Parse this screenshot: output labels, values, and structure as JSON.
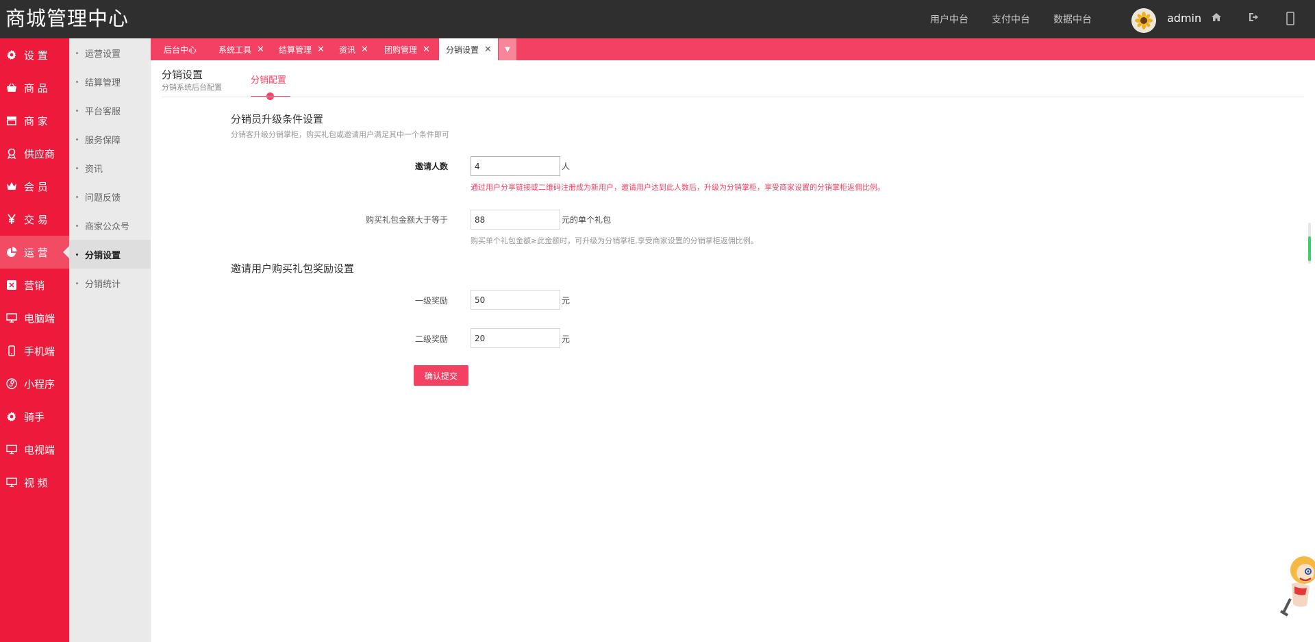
{
  "header": {
    "brand": "商城管理中心",
    "nav": [
      "用户中台",
      "支付中台",
      "数据中台"
    ],
    "username": "admin"
  },
  "sidebar": {
    "items": [
      {
        "label": "设 置",
        "icon": "gear-icon"
      },
      {
        "label": "商 品",
        "icon": "basket-icon"
      },
      {
        "label": "商 家",
        "icon": "store-icon"
      },
      {
        "label": "供应商",
        "icon": "badge-icon"
      },
      {
        "label": "会 员",
        "icon": "crown-icon"
      },
      {
        "label": "交 易",
        "icon": "yen-icon"
      },
      {
        "label": "运 营",
        "icon": "pie-chart-icon",
        "active": true
      },
      {
        "label": "营销",
        "icon": "coupon-icon"
      },
      {
        "label": "电脑端",
        "icon": "monitor-icon"
      },
      {
        "label": "手机端",
        "icon": "phone-icon"
      },
      {
        "label": "小程序",
        "icon": "mini-program-icon"
      },
      {
        "label": "骑手",
        "icon": "gear-icon"
      },
      {
        "label": "电视端",
        "icon": "monitor-icon"
      },
      {
        "label": "视 频",
        "icon": "monitor-icon"
      }
    ]
  },
  "subnav": {
    "items": [
      {
        "label": "运营设置"
      },
      {
        "label": "结算管理"
      },
      {
        "label": "平台客服"
      },
      {
        "label": "服务保障"
      },
      {
        "label": "资讯"
      },
      {
        "label": "问题反馈"
      },
      {
        "label": "商家公众号"
      },
      {
        "label": "分销设置",
        "active": true
      },
      {
        "label": "分销统计"
      }
    ]
  },
  "tabs": [
    {
      "label": "后台中心",
      "closable": false
    },
    {
      "label": "系统工具",
      "closable": true
    },
    {
      "label": "结算管理",
      "closable": true
    },
    {
      "label": "资讯",
      "closable": true
    },
    {
      "label": "团购管理",
      "closable": true
    },
    {
      "label": "分销设置",
      "closable": true,
      "active": true
    }
  ],
  "page": {
    "title": "分销设置",
    "subtitle": "分销系统后台配置",
    "sub_tab": "分销配置"
  },
  "form": {
    "section1": {
      "title": "分销员升级条件设置",
      "desc": "分销客升级分销掌柜，购买礼包或邀请用户满足其中一个条件即可"
    },
    "invite_count": {
      "label": "邀请人数",
      "value": "4",
      "unit": "人",
      "help": "通过用户分享链接或二维码注册成为新用户，邀请用户达到此人数后，升级为分销掌柜，享受商家设置的分销掌柜返佣比例。"
    },
    "gift_amount": {
      "label": "购买礼包金额大于等于",
      "value": "88",
      "unit": "元的单个礼包",
      "help": "购买单个礼包金额≥此金额时，可升级为分销掌柜,享受商家设置的分销掌柜返佣比例。"
    },
    "section2": {
      "title": "邀请用户购买礼包奖励设置"
    },
    "level1": {
      "label": "一级奖励",
      "value": "50",
      "unit": "元"
    },
    "level2": {
      "label": "二级奖励",
      "value": "20",
      "unit": "元"
    },
    "submit": "确认提交"
  },
  "colors": {
    "accent": "#f24162",
    "sidebar": "#ee1a3b",
    "topbar": "#2f2f2f"
  }
}
